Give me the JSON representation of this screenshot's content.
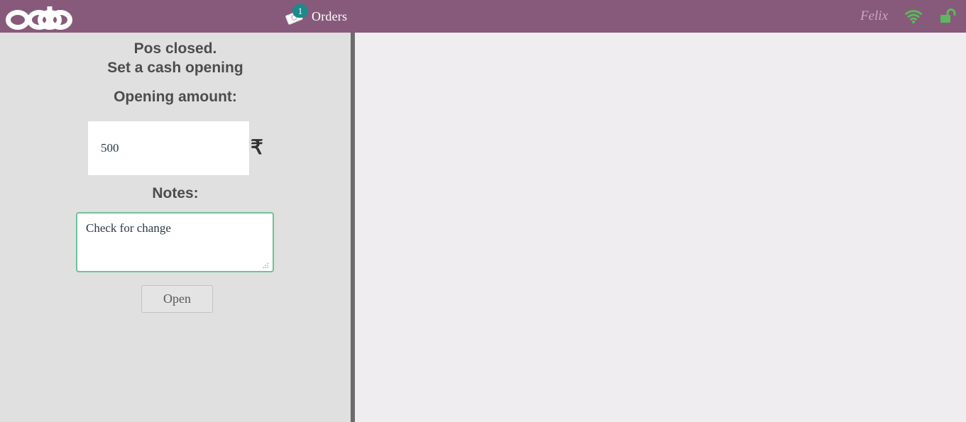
{
  "topbar": {
    "logo_text": "odoo",
    "logo_icon": "odoo-logo",
    "orders": {
      "label": "Orders",
      "badge_count": "1",
      "icon": "order-ticket-icon",
      "badge_color": "#1a8a8a"
    },
    "username": "Felix",
    "wifi_icon": "wifi-icon",
    "lock_icon": "unlock-icon",
    "status_icon_color": "#5cb85c",
    "background_color": "#875a7b"
  },
  "left_panel": {
    "headline_line1": "Pos closed.",
    "headline_line2": "Set a cash opening",
    "opening_amount_label": "Opening amount:",
    "opening_amount_value": "500",
    "opening_amount_placeholder": "",
    "currency_symbol": "₹",
    "notes_label": "Notes:",
    "notes_value": "Check for change",
    "notes_placeholder": "",
    "notes_focus_color": "#6fc295",
    "open_button_label": "Open",
    "background_color": "#e0e0e0"
  },
  "right_panel": {
    "background_color": "#efedef"
  },
  "divider": {
    "color": "#6b6b6b"
  }
}
